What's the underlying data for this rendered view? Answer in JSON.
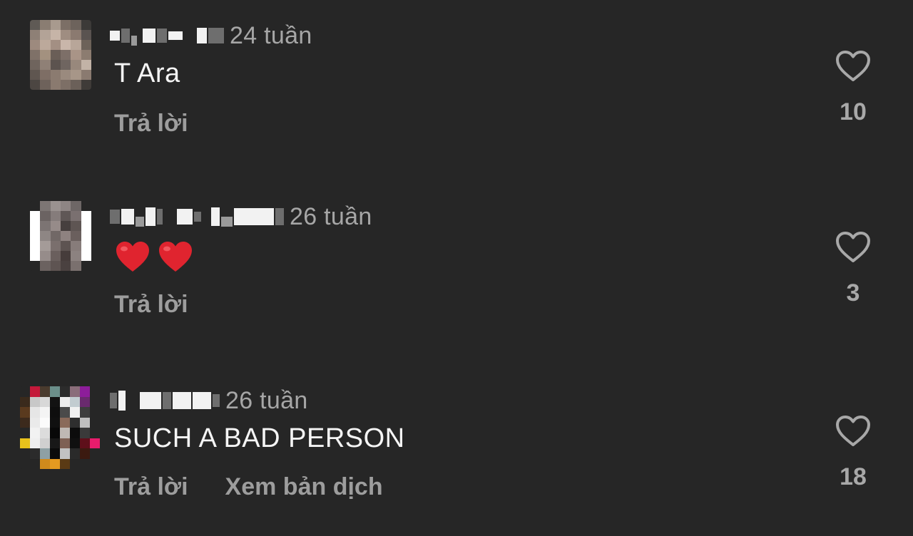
{
  "comments": [
    {
      "time": "24 tuần",
      "text": "T Ara",
      "actions": {
        "reply": "Trả lời"
      },
      "likes": "10",
      "icons": {
        "like": "heart-outline-icon"
      }
    },
    {
      "time": "26 tuần",
      "text_emoji": [
        "red-heart-emoji",
        "red-heart-emoji"
      ],
      "actions": {
        "reply": "Trả lời"
      },
      "likes": "3",
      "icons": {
        "like": "heart-outline-icon"
      }
    },
    {
      "time": "26 tuần",
      "text": "SUCH A BAD PERSON",
      "actions": {
        "reply": "Trả lời",
        "translate": "Xem bản dịch"
      },
      "likes": "18",
      "icons": {
        "like": "heart-outline-icon"
      }
    }
  ],
  "colors": {
    "background": "#262626",
    "primary_text": "#f5f5f5",
    "secondary_text": "#a6a6a6",
    "heart_emoji": "#e0242f"
  }
}
